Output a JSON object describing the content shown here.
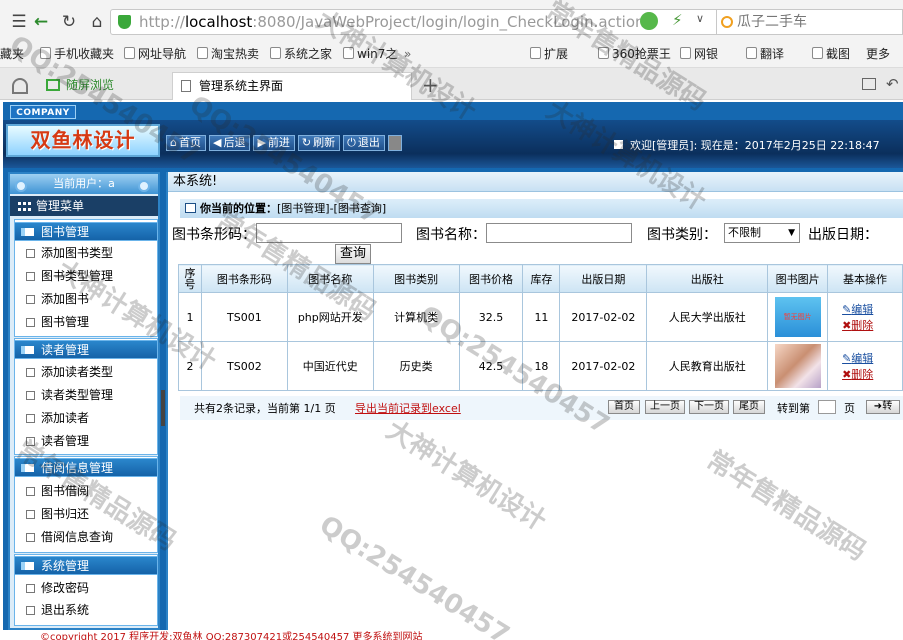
{
  "browser": {
    "url_host": "http://",
    "url_host_bold": "localhost",
    "url_path": ":8080/JavaWebProject/login/login_CheckLogin.action",
    "search_text": "瓜子二手车",
    "bookmarks": [
      "藏夹",
      "手机收藏夹",
      "网址导航",
      "淘宝热卖",
      "系统之家",
      "win7之",
      "»",
      "扩展",
      "360抢票王",
      "网银",
      "翻译",
      "截图",
      "更多"
    ],
    "tabs": [
      "随屏浏览",
      "管理系统主界面"
    ],
    "new_tab": "+"
  },
  "app": {
    "company_label": "COMPANY",
    "logo_text": "双鱼林设计",
    "topnav": [
      {
        "label": "首页",
        "icon": "home-icon"
      },
      {
        "label": "后退",
        "icon": "back-arrow-icon"
      },
      {
        "label": "前进",
        "icon": "forward-arrow-icon"
      },
      {
        "label": "刷新",
        "icon": "refresh-icon"
      },
      {
        "label": "退出",
        "icon": "power-icon"
      }
    ],
    "welcome": "欢迎[管理员]:  现在是：2017年2月25日 22:18:47",
    "current_user_label": "当前用户：a",
    "manage_menu": "管理菜单",
    "menu_groups": [
      {
        "title": "图书管理",
        "items": [
          "添加图书类型",
          "图书类型管理",
          "添加图书",
          "图书管理"
        ]
      },
      {
        "title": "读者管理",
        "items": [
          "添加读者类型",
          "读者类型管理",
          "添加读者",
          "读者管理"
        ]
      },
      {
        "title": "借阅信息管理",
        "items": [
          "图书借阅",
          "图书归还",
          "借阅信息查询"
        ]
      },
      {
        "title": "系统管理",
        "items": [
          "修改密码",
          "退出系统"
        ]
      }
    ],
    "main_header": "本系统!",
    "current_position": "你当前的位置：",
    "breadcrumb": "[图书管理]-[图书查询]",
    "search": {
      "barcode_label": "图书条形码：",
      "name_label": "图书名称：",
      "type_label": "图书类别：",
      "type_value": "不限制",
      "date_label": "出版日期：",
      "query_button": "查询"
    },
    "table": {
      "headers": [
        "序号",
        "图书条形码",
        "图书名称",
        "图书类别",
        "图书价格",
        "库存",
        "出版日期",
        "出版社",
        "图书图片",
        "基本操作"
      ],
      "rows": [
        [
          "1",
          "TS001",
          "php网站开发",
          "计算机类",
          "32.5",
          "11",
          "2017-02-02",
          "人民大学出版社",
          "暂无图片"
        ],
        [
          "2",
          "TS002",
          "中国近代史",
          "历史类",
          "42.5",
          "18",
          "2017-02-02",
          "人民教育出版社",
          ""
        ]
      ],
      "edit_label": "编辑",
      "delete_label": "删除"
    },
    "pager": {
      "summary": "共有2条记录，当前第 1/1 页",
      "export_link": "导出当前记录到excel",
      "first": "首页",
      "prev": "上一页",
      "next": "下一页",
      "last": "尾页",
      "goto_label": "转到第",
      "page_unit": "页",
      "go": "转"
    },
    "footer": "©copyright 2017 程序开发:双鱼林 QQ:287307421或254540457 更多系统到网站"
  },
  "watermarks": [
    "QQ:254540457",
    "大神计算机设计",
    "常年售精品源码",
    "QQ:254540457",
    "大神计算机设计",
    "常年售精品源码",
    "QQ:254540457",
    "大神计算机设计",
    "常年售精品源码",
    "QQ:254540457",
    "常年售精品源码",
    "大神计算机设计"
  ]
}
